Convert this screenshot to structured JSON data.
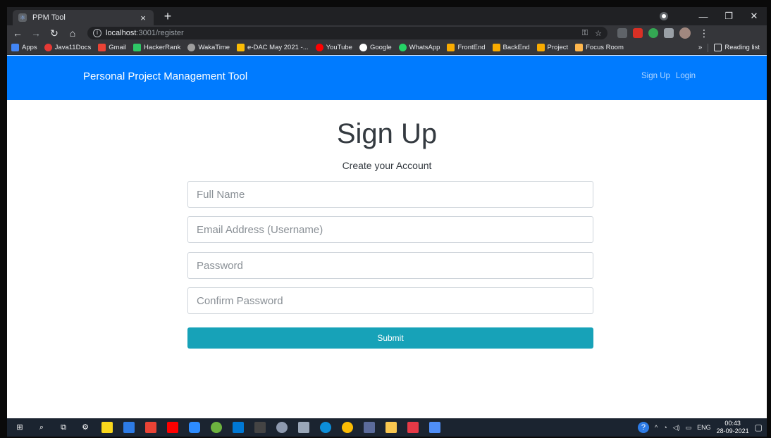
{
  "browser": {
    "tab_title": "PPM Tool",
    "tab_close": "×",
    "new_tab": "+",
    "url_host": "localhost",
    "url_path": ":3001/register",
    "window_controls": [
      "—",
      "❐",
      "✕"
    ]
  },
  "bookmarks": [
    {
      "label": "Apps",
      "color": "#4285f4"
    },
    {
      "label": "Java11Docs",
      "color": "#e53935"
    },
    {
      "label": "Gmail",
      "color": "#ea4335"
    },
    {
      "label": "HackerRank",
      "color": "#2ec866"
    },
    {
      "label": "WakaTime",
      "color": "#9e9e9e"
    },
    {
      "label": "e-DAC May 2021 -...",
      "color": "#fbbc04"
    },
    {
      "label": "YouTube",
      "color": "#ff0000"
    },
    {
      "label": "Google",
      "color": "#ffffff"
    },
    {
      "label": "WhatsApp",
      "color": "#25d366"
    },
    {
      "label": "FrontEnd",
      "color": "#f9ab00"
    },
    {
      "label": "BackEnd",
      "color": "#f9ab00"
    },
    {
      "label": "Project",
      "color": "#f9ab00"
    },
    {
      "label": "Focus Room",
      "color": "#ffb74d"
    }
  ],
  "bookmarks_more": "»",
  "reading_list": "Reading list",
  "app": {
    "brand": "Personal Project Management Tool",
    "nav_signup": "Sign Up",
    "nav_login": "Login"
  },
  "form": {
    "heading": "Sign Up",
    "subheading": "Create your Account",
    "full_name_placeholder": "Full Name",
    "email_placeholder": "Email Address (Username)",
    "password_placeholder": "Password",
    "confirm_password_placeholder": "Confirm Password",
    "submit_label": "Submit"
  },
  "taskbar": {
    "language": "ENG",
    "time": "00:43",
    "date": "28-09-2021"
  },
  "colors": {
    "navbar": "#007bff",
    "submit": "#17a2b8"
  }
}
